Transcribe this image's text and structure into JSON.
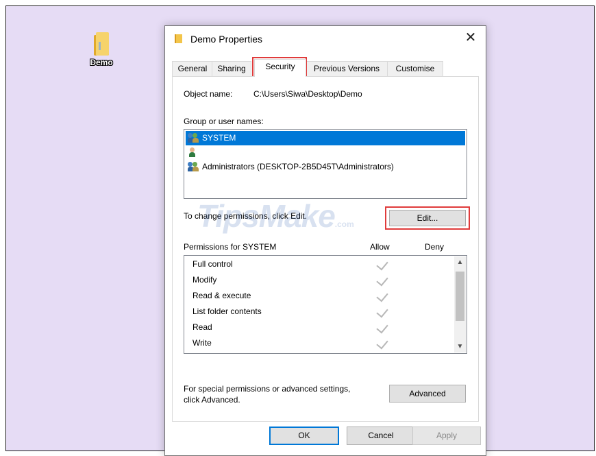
{
  "desktop": {
    "icon_label": "Demo"
  },
  "dialog": {
    "title": "Demo Properties",
    "close_symbol": "✕",
    "tabs": [
      {
        "label": "General"
      },
      {
        "label": "Sharing"
      },
      {
        "label": "Security"
      },
      {
        "label": "Previous Versions"
      },
      {
        "label": "Customise"
      }
    ],
    "active_tab": "Security",
    "object_name_label": "Object name:",
    "object_name_value": "C:\\Users\\Siwa\\Desktop\\Demo",
    "group_label": "Group or user names:",
    "users": [
      {
        "name": "SYSTEM",
        "selected": true,
        "icon": "users-group-icon"
      },
      {
        "name": "",
        "selected": false,
        "icon": "user-icon"
      },
      {
        "name": "Administrators (DESKTOP-2B5D45T\\Administrators)",
        "selected": false,
        "icon": "users-group-icon"
      }
    ],
    "change_text": "To change permissions, click Edit.",
    "edit_button": "Edit...",
    "permissions_for": "Permissions for SYSTEM",
    "allow_header": "Allow",
    "deny_header": "Deny",
    "permissions": [
      {
        "name": "Full control",
        "allow": true,
        "deny": false
      },
      {
        "name": "Modify",
        "allow": true,
        "deny": false
      },
      {
        "name": "Read & execute",
        "allow": true,
        "deny": false
      },
      {
        "name": "List folder contents",
        "allow": true,
        "deny": false
      },
      {
        "name": "Read",
        "allow": true,
        "deny": false
      },
      {
        "name": "Write",
        "allow": true,
        "deny": false
      }
    ],
    "special_text_line1": "For special permissions or advanced settings,",
    "special_text_line2": "click Advanced.",
    "advanced_button": "Advanced",
    "ok_button": "OK",
    "cancel_button": "Cancel",
    "apply_button": "Apply"
  },
  "watermark": {
    "text": "TipsMake",
    "suffix": ".com"
  },
  "colors": {
    "desktop_bg": "#e6dcf5",
    "selection": "#0078d7",
    "highlight_box": "#e03b3b"
  }
}
